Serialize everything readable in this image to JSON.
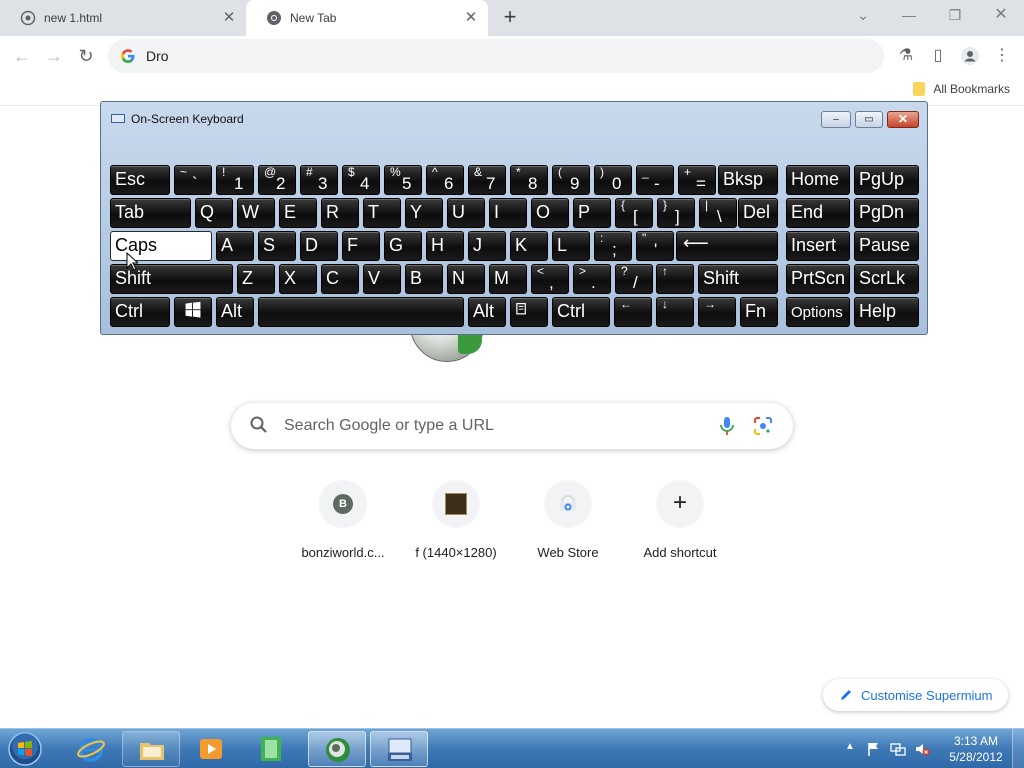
{
  "browser": {
    "tabs": [
      {
        "label": "new 1.html",
        "active": false
      },
      {
        "label": "New Tab",
        "active": true
      }
    ],
    "omnibox_text": "Dro",
    "bookmarks_bar": {
      "all_bookmarks": "All Bookmarks"
    }
  },
  "newtab": {
    "search_placeholder": "Search Google or type a URL",
    "shortcuts": [
      {
        "label": "bonziworld.c...",
        "icon": "B"
      },
      {
        "label": "f (1440×1280)",
        "icon": "image-thumbnail"
      },
      {
        "label": "Web Store",
        "icon": "web-store-icon"
      },
      {
        "label": "Add shortcut",
        "icon": "+"
      }
    ],
    "customise_label": "Customise Supermium"
  },
  "osk": {
    "title": "On-Screen Keyboard",
    "title_buttons": {
      "min": "–",
      "max": "▭",
      "close": "✕"
    },
    "keys": {
      "esc": "Esc",
      "bksp": "Bksp",
      "home": "Home",
      "pgup": "PgUp",
      "tab": "Tab",
      "del": "Del",
      "end": "End",
      "pgdn": "PgDn",
      "caps": "Caps",
      "insert": "Insert",
      "pause": "Pause",
      "shift": "Shift",
      "shift_r": "Shift",
      "prtscn": "PrtScn",
      "scrlk": "ScrLk",
      "ctrl": "Ctrl",
      "alt": "Alt",
      "alt_r": "Alt",
      "ctrl_r": "Ctrl",
      "fn": "Fn",
      "options": "Options",
      "help": "Help",
      "row1": [
        {
          "s": "~",
          "m": "`"
        },
        {
          "s": "!",
          "m": "1"
        },
        {
          "s": "@",
          "m": "2"
        },
        {
          "s": "#",
          "m": "3"
        },
        {
          "s": "$",
          "m": "4"
        },
        {
          "s": "%",
          "m": "5"
        },
        {
          "s": "^",
          "m": "6"
        },
        {
          "s": "&",
          "m": "7"
        },
        {
          "s": "*",
          "m": "8"
        },
        {
          "s": "(",
          "m": "9"
        },
        {
          "s": ")",
          "m": "0"
        },
        {
          "s": "_",
          "m": "-"
        },
        {
          "s": "+",
          "m": "="
        }
      ],
      "row2": [
        "Q",
        "W",
        "E",
        "R",
        "T",
        "Y",
        "U",
        "I",
        "O",
        "P"
      ],
      "row2_sym": [
        {
          "s": "{",
          "m": "["
        },
        {
          "s": "}",
          "m": "]"
        },
        {
          "s": "|",
          "m": "\\"
        }
      ],
      "row3": [
        "A",
        "S",
        "D",
        "F",
        "G",
        "H",
        "J",
        "K",
        "L"
      ],
      "row3_sym": [
        {
          "s": ":",
          "m": ";"
        },
        {
          "s": "\"",
          "m": "'"
        }
      ],
      "row4": [
        "Z",
        "X",
        "C",
        "V",
        "B",
        "N",
        "M"
      ],
      "row4_sym": [
        {
          "s": "<",
          "m": ","
        },
        {
          "s": ">",
          "m": "."
        },
        {
          "s": "?",
          "m": "/"
        }
      ],
      "arrows": {
        "up": "↑",
        "left": "←",
        "down": "↓",
        "right": "→"
      },
      "enter": "⟵"
    }
  },
  "taskbar": {
    "clock_time": "3:13 AM",
    "clock_date": "5/28/2012",
    "tray_arrow": "▲"
  }
}
